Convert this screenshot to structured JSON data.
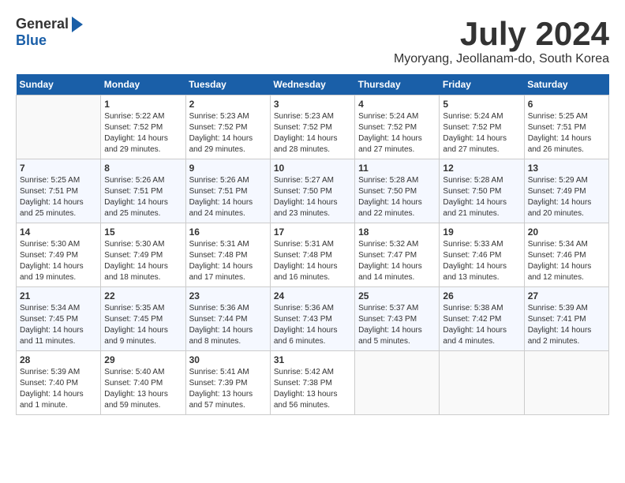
{
  "header": {
    "logo_general": "General",
    "logo_blue": "Blue",
    "month_title": "July 2024",
    "location": "Myoryang, Jeollanam-do, South Korea"
  },
  "days_of_week": [
    "Sunday",
    "Monday",
    "Tuesday",
    "Wednesday",
    "Thursday",
    "Friday",
    "Saturday"
  ],
  "weeks": [
    [
      {
        "num": "",
        "info": ""
      },
      {
        "num": "1",
        "info": "Sunrise: 5:22 AM\nSunset: 7:52 PM\nDaylight: 14 hours\nand 29 minutes."
      },
      {
        "num": "2",
        "info": "Sunrise: 5:23 AM\nSunset: 7:52 PM\nDaylight: 14 hours\nand 29 minutes."
      },
      {
        "num": "3",
        "info": "Sunrise: 5:23 AM\nSunset: 7:52 PM\nDaylight: 14 hours\nand 28 minutes."
      },
      {
        "num": "4",
        "info": "Sunrise: 5:24 AM\nSunset: 7:52 PM\nDaylight: 14 hours\nand 27 minutes."
      },
      {
        "num": "5",
        "info": "Sunrise: 5:24 AM\nSunset: 7:52 PM\nDaylight: 14 hours\nand 27 minutes."
      },
      {
        "num": "6",
        "info": "Sunrise: 5:25 AM\nSunset: 7:51 PM\nDaylight: 14 hours\nand 26 minutes."
      }
    ],
    [
      {
        "num": "7",
        "info": "Sunrise: 5:25 AM\nSunset: 7:51 PM\nDaylight: 14 hours\nand 25 minutes."
      },
      {
        "num": "8",
        "info": "Sunrise: 5:26 AM\nSunset: 7:51 PM\nDaylight: 14 hours\nand 25 minutes."
      },
      {
        "num": "9",
        "info": "Sunrise: 5:26 AM\nSunset: 7:51 PM\nDaylight: 14 hours\nand 24 minutes."
      },
      {
        "num": "10",
        "info": "Sunrise: 5:27 AM\nSunset: 7:50 PM\nDaylight: 14 hours\nand 23 minutes."
      },
      {
        "num": "11",
        "info": "Sunrise: 5:28 AM\nSunset: 7:50 PM\nDaylight: 14 hours\nand 22 minutes."
      },
      {
        "num": "12",
        "info": "Sunrise: 5:28 AM\nSunset: 7:50 PM\nDaylight: 14 hours\nand 21 minutes."
      },
      {
        "num": "13",
        "info": "Sunrise: 5:29 AM\nSunset: 7:49 PM\nDaylight: 14 hours\nand 20 minutes."
      }
    ],
    [
      {
        "num": "14",
        "info": "Sunrise: 5:30 AM\nSunset: 7:49 PM\nDaylight: 14 hours\nand 19 minutes."
      },
      {
        "num": "15",
        "info": "Sunrise: 5:30 AM\nSunset: 7:49 PM\nDaylight: 14 hours\nand 18 minutes."
      },
      {
        "num": "16",
        "info": "Sunrise: 5:31 AM\nSunset: 7:48 PM\nDaylight: 14 hours\nand 17 minutes."
      },
      {
        "num": "17",
        "info": "Sunrise: 5:31 AM\nSunset: 7:48 PM\nDaylight: 14 hours\nand 16 minutes."
      },
      {
        "num": "18",
        "info": "Sunrise: 5:32 AM\nSunset: 7:47 PM\nDaylight: 14 hours\nand 14 minutes."
      },
      {
        "num": "19",
        "info": "Sunrise: 5:33 AM\nSunset: 7:46 PM\nDaylight: 14 hours\nand 13 minutes."
      },
      {
        "num": "20",
        "info": "Sunrise: 5:34 AM\nSunset: 7:46 PM\nDaylight: 14 hours\nand 12 minutes."
      }
    ],
    [
      {
        "num": "21",
        "info": "Sunrise: 5:34 AM\nSunset: 7:45 PM\nDaylight: 14 hours\nand 11 minutes."
      },
      {
        "num": "22",
        "info": "Sunrise: 5:35 AM\nSunset: 7:45 PM\nDaylight: 14 hours\nand 9 minutes."
      },
      {
        "num": "23",
        "info": "Sunrise: 5:36 AM\nSunset: 7:44 PM\nDaylight: 14 hours\nand 8 minutes."
      },
      {
        "num": "24",
        "info": "Sunrise: 5:36 AM\nSunset: 7:43 PM\nDaylight: 14 hours\nand 6 minutes."
      },
      {
        "num": "25",
        "info": "Sunrise: 5:37 AM\nSunset: 7:43 PM\nDaylight: 14 hours\nand 5 minutes."
      },
      {
        "num": "26",
        "info": "Sunrise: 5:38 AM\nSunset: 7:42 PM\nDaylight: 14 hours\nand 4 minutes."
      },
      {
        "num": "27",
        "info": "Sunrise: 5:39 AM\nSunset: 7:41 PM\nDaylight: 14 hours\nand 2 minutes."
      }
    ],
    [
      {
        "num": "28",
        "info": "Sunrise: 5:39 AM\nSunset: 7:40 PM\nDaylight: 14 hours\nand 1 minute."
      },
      {
        "num": "29",
        "info": "Sunrise: 5:40 AM\nSunset: 7:40 PM\nDaylight: 13 hours\nand 59 minutes."
      },
      {
        "num": "30",
        "info": "Sunrise: 5:41 AM\nSunset: 7:39 PM\nDaylight: 13 hours\nand 57 minutes."
      },
      {
        "num": "31",
        "info": "Sunrise: 5:42 AM\nSunset: 7:38 PM\nDaylight: 13 hours\nand 56 minutes."
      },
      {
        "num": "",
        "info": ""
      },
      {
        "num": "",
        "info": ""
      },
      {
        "num": "",
        "info": ""
      }
    ]
  ]
}
